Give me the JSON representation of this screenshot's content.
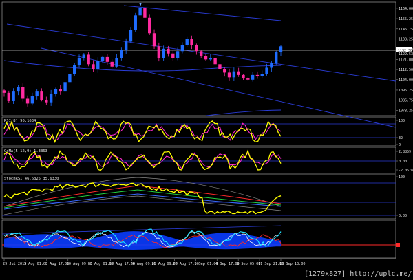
{
  "colors": {
    "background": "#000000",
    "frame": "#8a8a8a",
    "bull_candle": "#1f6cff",
    "bear_candle": "#ff2aa0",
    "channel": "#2a3cd6",
    "level_line": "#ffffff",
    "yellow": "#ffff00",
    "magenta": "#ff2ad0",
    "red_level": "#ff2a2a",
    "cloud": "#0a3cff",
    "cyan": "#20e0ff"
  },
  "main_axis": {
    "ticks": [
      "1164.00",
      "1155.25",
      "1146.75",
      "1138.25",
      "1129.50",
      "1121.00",
      "1112.50",
      "1104.00",
      "1095.25",
      "1086.75",
      "1078.25"
    ],
    "last_price": "1132.38",
    "last_price_box": "1129.53",
    "ylim": [
      1075,
      1168
    ]
  },
  "indicators": {
    "rsi": {
      "label": "RSI(8) 90.1634",
      "ticks": [
        "100",
        "32",
        "0"
      ]
    },
    "osma": {
      "label": "OsMA(5,12,9) 1.3363",
      "ticks": [
        "2.8859",
        "0.00",
        "-2.0578"
      ]
    },
    "stoch": {
      "label": "StochRSI 46.6325 35.6330",
      "ticks": [
        "100",
        "0.00"
      ]
    },
    "bottom": {
      "label": "",
      "ticks": []
    }
  },
  "time_axis": {
    "labels": [
      "29 Jul 2015",
      "3 Aug 01:00",
      "5 Aug 17:00",
      "10 Aug 09:00",
      "13 Aug 01:00",
      "17 Aug 17:00",
      "20 Aug 09:00",
      "25 Aug 09:00",
      "27 Aug 17:00",
      "1 Sep 01:00",
      "4 Sep 17:00",
      "9 Sep 05:00",
      "11 Sep 21:00",
      "16 Sep 13:00"
    ]
  },
  "watermark": "[1279x827] http://uplc.me/",
  "chart_data": {
    "type": "line",
    "title": "",
    "xlabel": "",
    "ylabel": "",
    "series": [
      {
        "values": [
          1093,
          1086,
          1094,
          1098,
          1088,
          1084,
          1090,
          1094,
          1087,
          1085,
          1092,
          1096,
          1094,
          1102,
          1109,
          1116,
          1122,
          1125,
          1117,
          1113,
          1120,
          1123,
          1119,
          1115,
          1122,
          1129,
          1136,
          1146,
          1158,
          1164,
          1156,
          1143,
          1132,
          1122,
          1130,
          1126,
          1122,
          1128,
          1133,
          1138,
          1133,
          1128,
          1124,
          1121,
          1122,
          1117,
          1113,
          1110,
          1106,
          1111,
          1108,
          1105,
          1104,
          1108,
          1107,
          1109,
          1114,
          1118,
          1127,
          1132
        ]
      }
    ]
  }
}
